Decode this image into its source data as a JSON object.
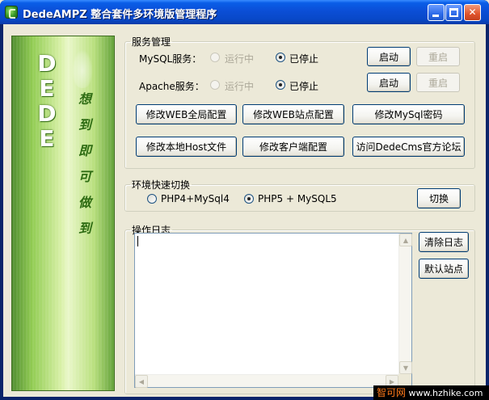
{
  "window": {
    "title": "DedeAMPZ 整合套件多环境版管理程序",
    "min_glyph": "",
    "max_glyph": "",
    "close_glyph": "✕"
  },
  "sidebar": {
    "letters": [
      "D",
      "E",
      "D",
      "E"
    ],
    "slogan": [
      "想",
      "到",
      "即",
      "可",
      "做",
      "到"
    ]
  },
  "service": {
    "legend": "服务管理",
    "mysql": {
      "label": "MySQL服务：",
      "running_label": "运行中",
      "stopped_label": "已停止",
      "start_button": "启动",
      "restart_button": "重启"
    },
    "apache": {
      "label": "Apache服务：",
      "running_label": "运行中",
      "stopped_label": "已停止",
      "start_button": "启动",
      "restart_button": "重启"
    },
    "buttons": {
      "web_global": "修改WEB全局配置",
      "web_site": "修改WEB站点配置",
      "mysql_password": "修改MySql密码",
      "hosts": "修改本地Host文件",
      "client": "修改客户端配置",
      "forum": "访问DedeCms官方论坛"
    }
  },
  "env": {
    "legend": "环境快速切换",
    "option1": "PHP4+MySql4",
    "option2": "PHP5 + MySQL5",
    "switch_button": "切换"
  },
  "log": {
    "legend": "操作日志",
    "clear_button": "清除日志",
    "default_site_button": "默认站点"
  },
  "watermark": {
    "brand": "智可网",
    "url": "www.hzhike.com"
  },
  "icons": {
    "app": "dede-app-icon",
    "minimize": "minimize-icon",
    "maximize": "maximize-icon",
    "close": "close-icon"
  }
}
